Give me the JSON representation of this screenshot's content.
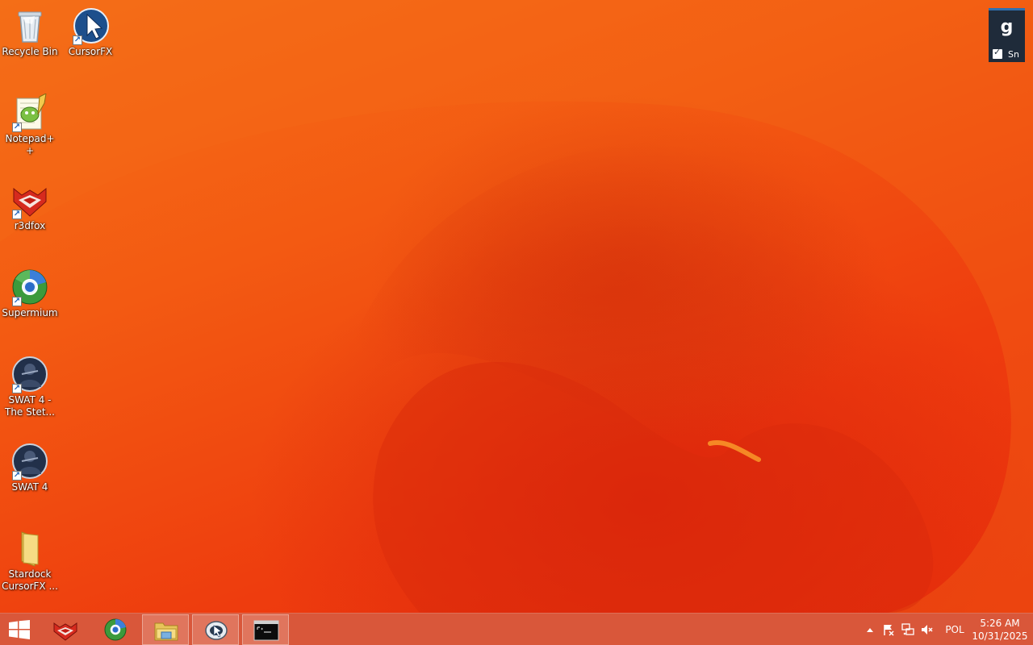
{
  "desktop": {
    "icons": [
      {
        "label": "Recycle Bin"
      },
      {
        "label": "CursorFX"
      },
      {
        "label": "Notepad++"
      },
      {
        "label": "r3dfox"
      },
      {
        "label": "Supermium"
      },
      {
        "label": "SWAT 4 - The Stet..."
      },
      {
        "label": "SWAT 4"
      },
      {
        "label": "Stardock CursorFX ..."
      }
    ]
  },
  "gadget": {
    "letter": "g",
    "checkbox_label": "Sn",
    "checked": true
  },
  "taskbar": {
    "apps": [
      {
        "icon": "r3dfox-icon",
        "active": false
      },
      {
        "icon": "supermium-icon",
        "active": false
      },
      {
        "icon": "file-explorer-icon",
        "active": true
      },
      {
        "icon": "cursorfx-icon",
        "active": true
      },
      {
        "icon": "command-prompt-icon",
        "active": true
      }
    ]
  },
  "tray": {
    "language": "POL",
    "time": "5:26 AM",
    "date": "10/31/2025"
  },
  "colors": {
    "wallpaper": "#f25a14",
    "taskbar": "#d9573a"
  }
}
